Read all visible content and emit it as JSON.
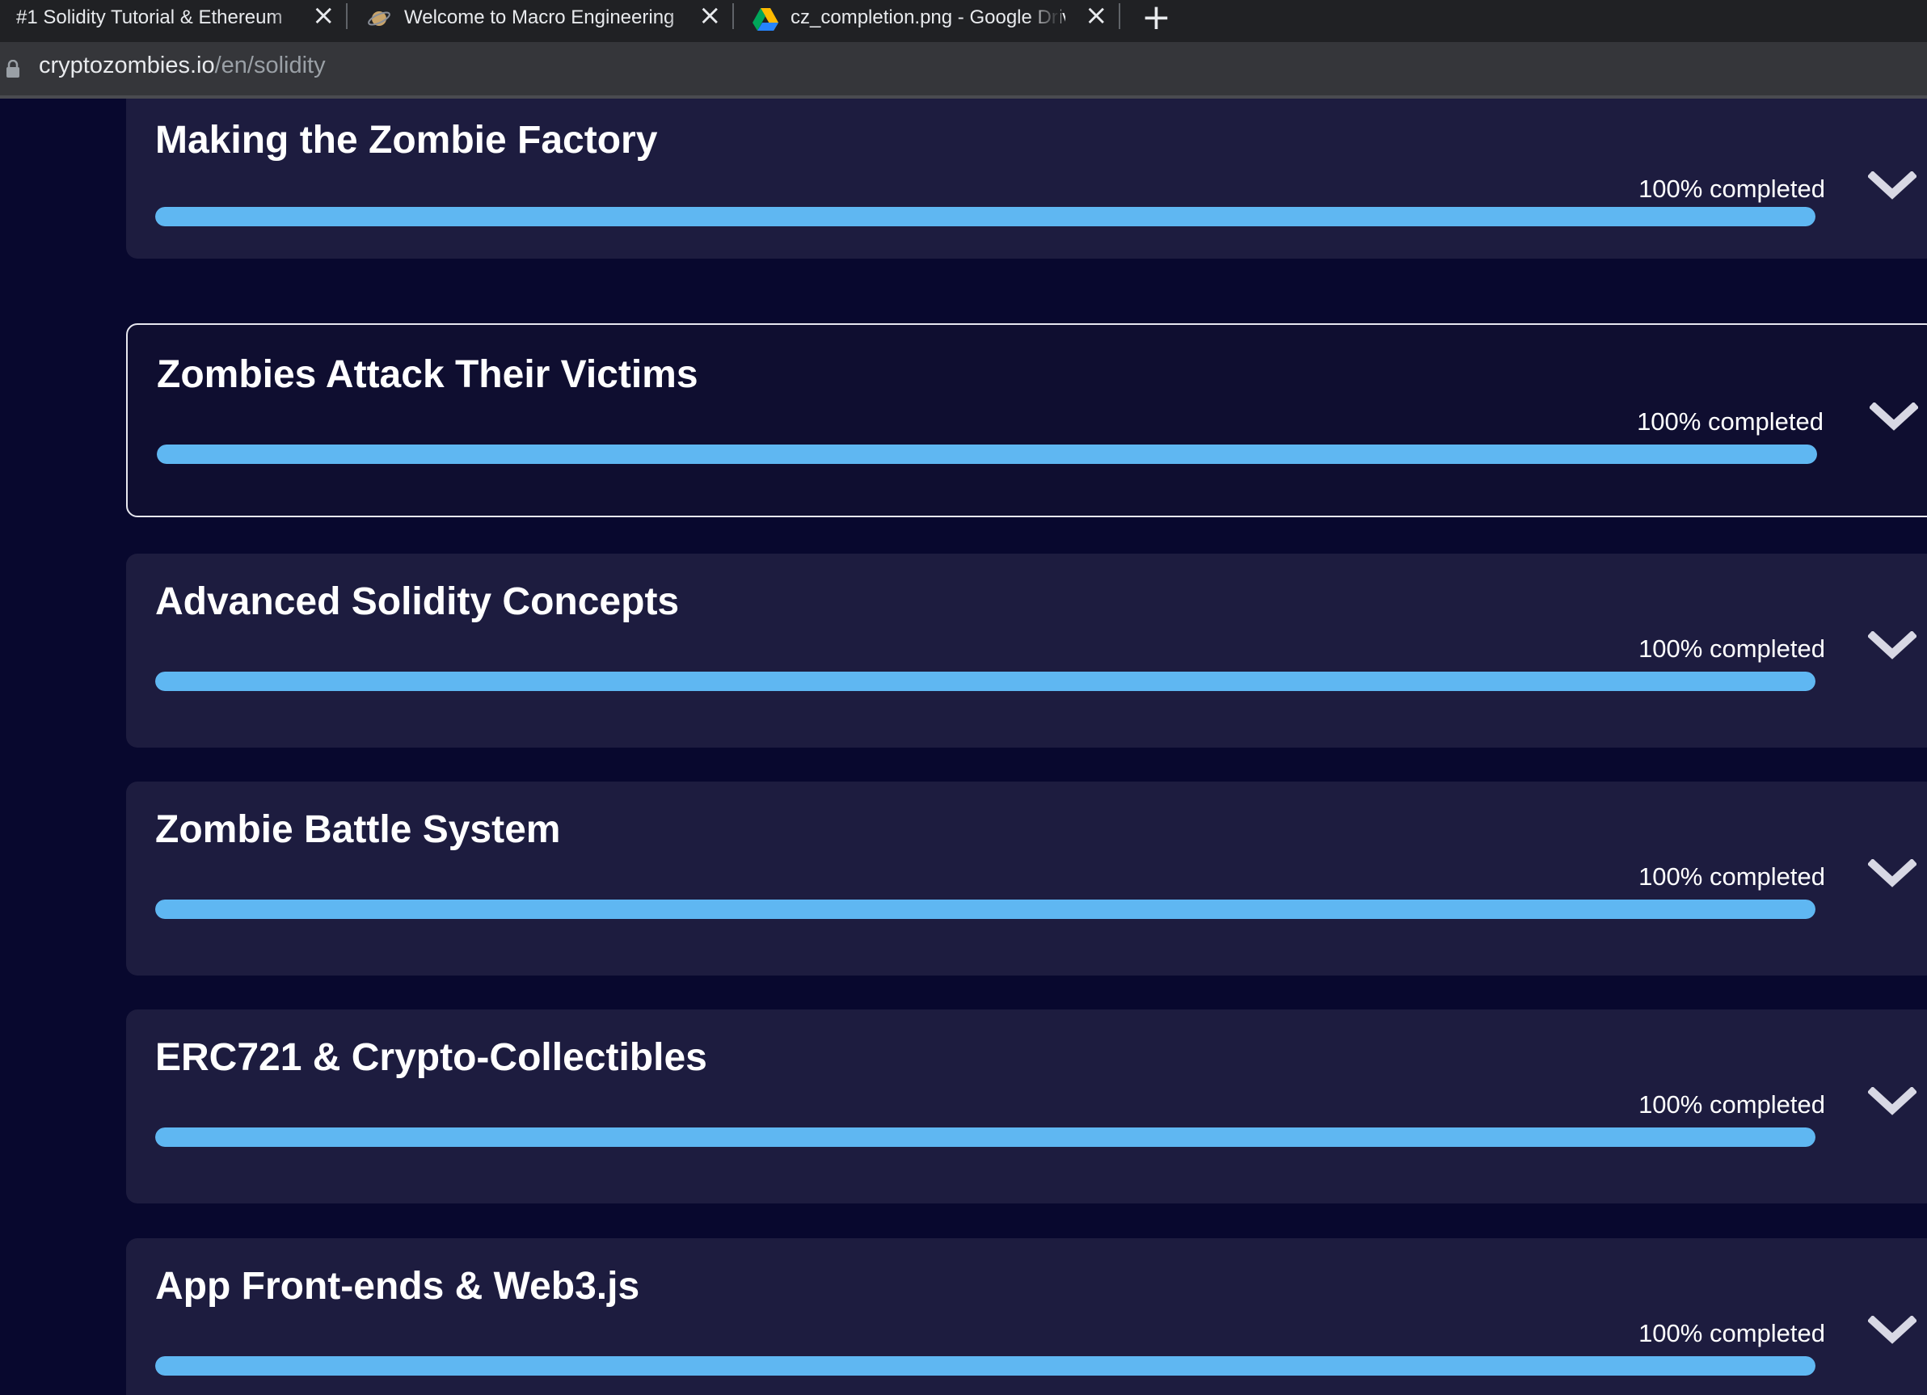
{
  "browser": {
    "tabs": [
      {
        "title": "#1 Solidity Tutorial & Ethereum",
        "icon": "zombie-favicon"
      },
      {
        "title": "Welcome to Macro Engineering",
        "icon": "planet-favicon"
      },
      {
        "title": "cz_completion.png - Google Drive",
        "icon": "google-drive-icon"
      }
    ],
    "new_tab_symbol": "+",
    "url_host": "cryptozombies.io",
    "url_path": "/en/solidity"
  },
  "colors": {
    "page_bg": "#08082e",
    "card_bg": "#1d1c3f",
    "progress_fill": "#5fb7f2",
    "text": "#ffffff"
  },
  "lessons": [
    {
      "title": "Making the Zombie Factory",
      "progress_label": "100% completed",
      "progress": 1.0
    },
    {
      "title": "Zombies Attack Their Victims",
      "progress_label": "100% completed",
      "progress": 1.0,
      "focused": true
    },
    {
      "title": "Advanced Solidity Concepts",
      "progress_label": "100% completed",
      "progress": 1.0
    },
    {
      "title": "Zombie Battle System",
      "progress_label": "100% completed",
      "progress": 1.0
    },
    {
      "title": "ERC721 & Crypto-Collectibles",
      "progress_label": "100% completed",
      "progress": 1.0
    },
    {
      "title": "App Front-ends & Web3.js",
      "progress_label": "100% completed",
      "progress": 1.0
    }
  ]
}
